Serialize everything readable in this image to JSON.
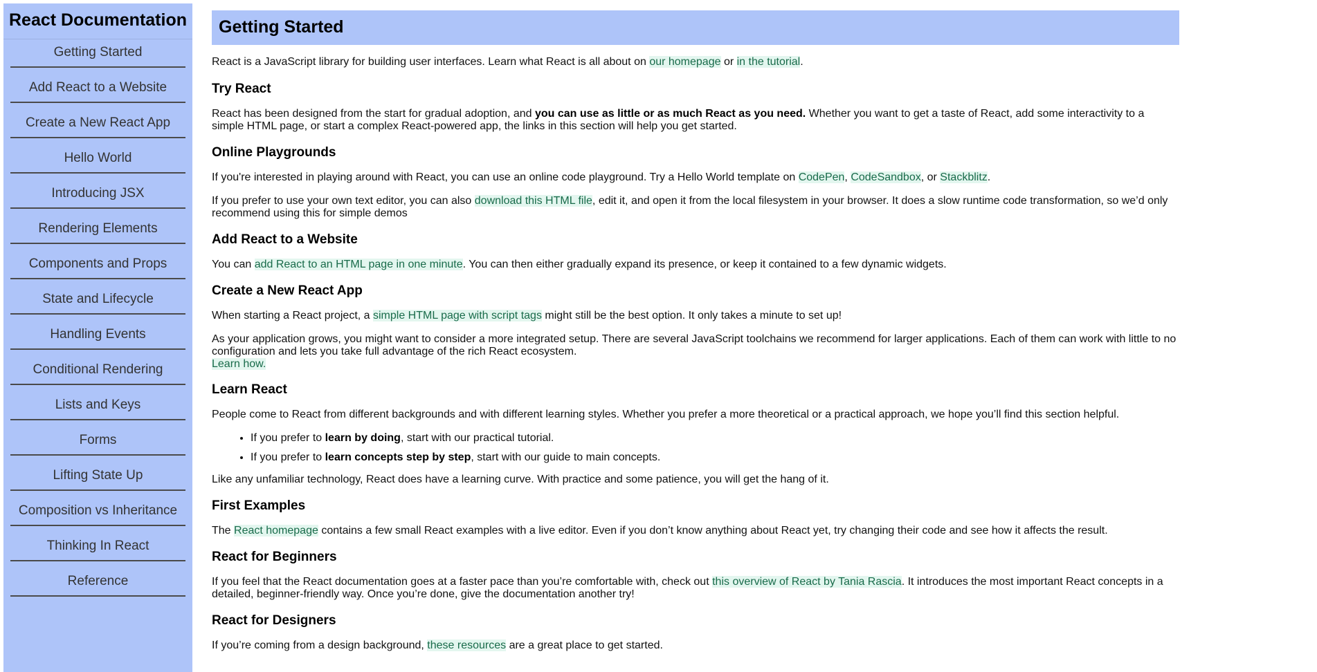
{
  "sidebar": {
    "title": "React Documentation",
    "items": [
      "Getting Started",
      "Add React to a Website",
      "Create a New React App",
      "Hello World",
      "Introducing JSX",
      "Rendering Elements",
      "Components and Props",
      "State and Lifecycle",
      "Handling Events",
      "Conditional Rendering",
      "Lists and Keys",
      "Forms",
      "Lifting State Up",
      "Composition vs Inheritance",
      "Thinking In React",
      "Reference"
    ]
  },
  "main": {
    "title": "Getting Started",
    "intro": {
      "t1": "React is a JavaScript library for building user interfaces. Learn what React is all about on ",
      "link1": "our homepage",
      "t2": " or ",
      "link2": "in the tutorial",
      "t3": "."
    },
    "try": {
      "heading": "Try React",
      "t1": "React has been designed from the start for gradual adoption, and ",
      "bold": "you can use as little or as much React as you need.",
      "t2": " Whether you want to get a taste of React, add some interactivity to a simple HTML page, or start a complex React-powered app, the links in this section will help you get started."
    },
    "playgrounds": {
      "heading": "Online Playgrounds",
      "p1": {
        "t1": "If you're interested in playing around with React, you can use an online code playground. Try a Hello World template on ",
        "link1": "CodePen",
        "t2": ", ",
        "link2": "CodeSandbox",
        "t3": ", or ",
        "link3": "Stackblitz",
        "t4": "."
      },
      "p2": {
        "t1": "If you prefer to use your own text editor, you can also ",
        "link1": "download this HTML file",
        "t2": ", edit it, and open it from the local filesystem in your browser. It does a slow runtime code transformation, so we’d only recommend using this for simple demos"
      }
    },
    "website": {
      "heading": "Add React to a Website",
      "t1": "You can ",
      "link1": "add React to an HTML page in one minute",
      "t2": ". You can then either gradually expand its presence, or keep it contained to a few dynamic widgets."
    },
    "newapp": {
      "heading": "Create a New React App",
      "p1": {
        "t1": "When starting a React project, a ",
        "link1": "simple HTML page with script tags",
        "t2": " might still be the best option. It only takes a minute to set up!"
      },
      "p2": {
        "t1": "As your application grows, you might want to consider a more integrated setup. There are several JavaScript toolchains we recommend for larger applications. Each of them can work with little to no configuration and lets you take full advantage of the rich React ecosystem.",
        "link1": "Learn how."
      }
    },
    "learn": {
      "heading": "Learn React",
      "p1": "People come to React from different backgrounds and with different learning styles. Whether you prefer a more theoretical or a practical approach, we hope you’ll find this section helpful.",
      "bullets": [
        {
          "t1": "If you prefer to ",
          "bold": "learn by doing",
          "t2": ", start with our practical tutorial."
        },
        {
          "t1": "If you prefer to ",
          "bold": "learn concepts step by step",
          "t2": ", start with our guide to main concepts."
        }
      ],
      "p2": "Like any unfamiliar technology, React does have a learning curve. With practice and some patience, you will get the hang of it."
    },
    "examples": {
      "heading": "First Examples",
      "t1": "The ",
      "link1": "React homepage",
      "t2": " contains a few small React examples with a live editor. Even if you don’t know anything about React yet, try changing their code and see how it affects the result."
    },
    "beginners": {
      "heading": "React for Beginners",
      "t1": "If you feel that the React documentation goes at a faster pace than you’re comfortable with, check out ",
      "link1": "this overview of React by Tania Rascia",
      "t2": ". It introduces the most important React concepts in a detailed, beginner-friendly way. Once you’re done, give the documentation another try!"
    },
    "designers": {
      "heading": "React for Designers",
      "t1": "If you’re coming from a design background, ",
      "link1": "these resources",
      "t2": " are a great place to get started."
    }
  }
}
